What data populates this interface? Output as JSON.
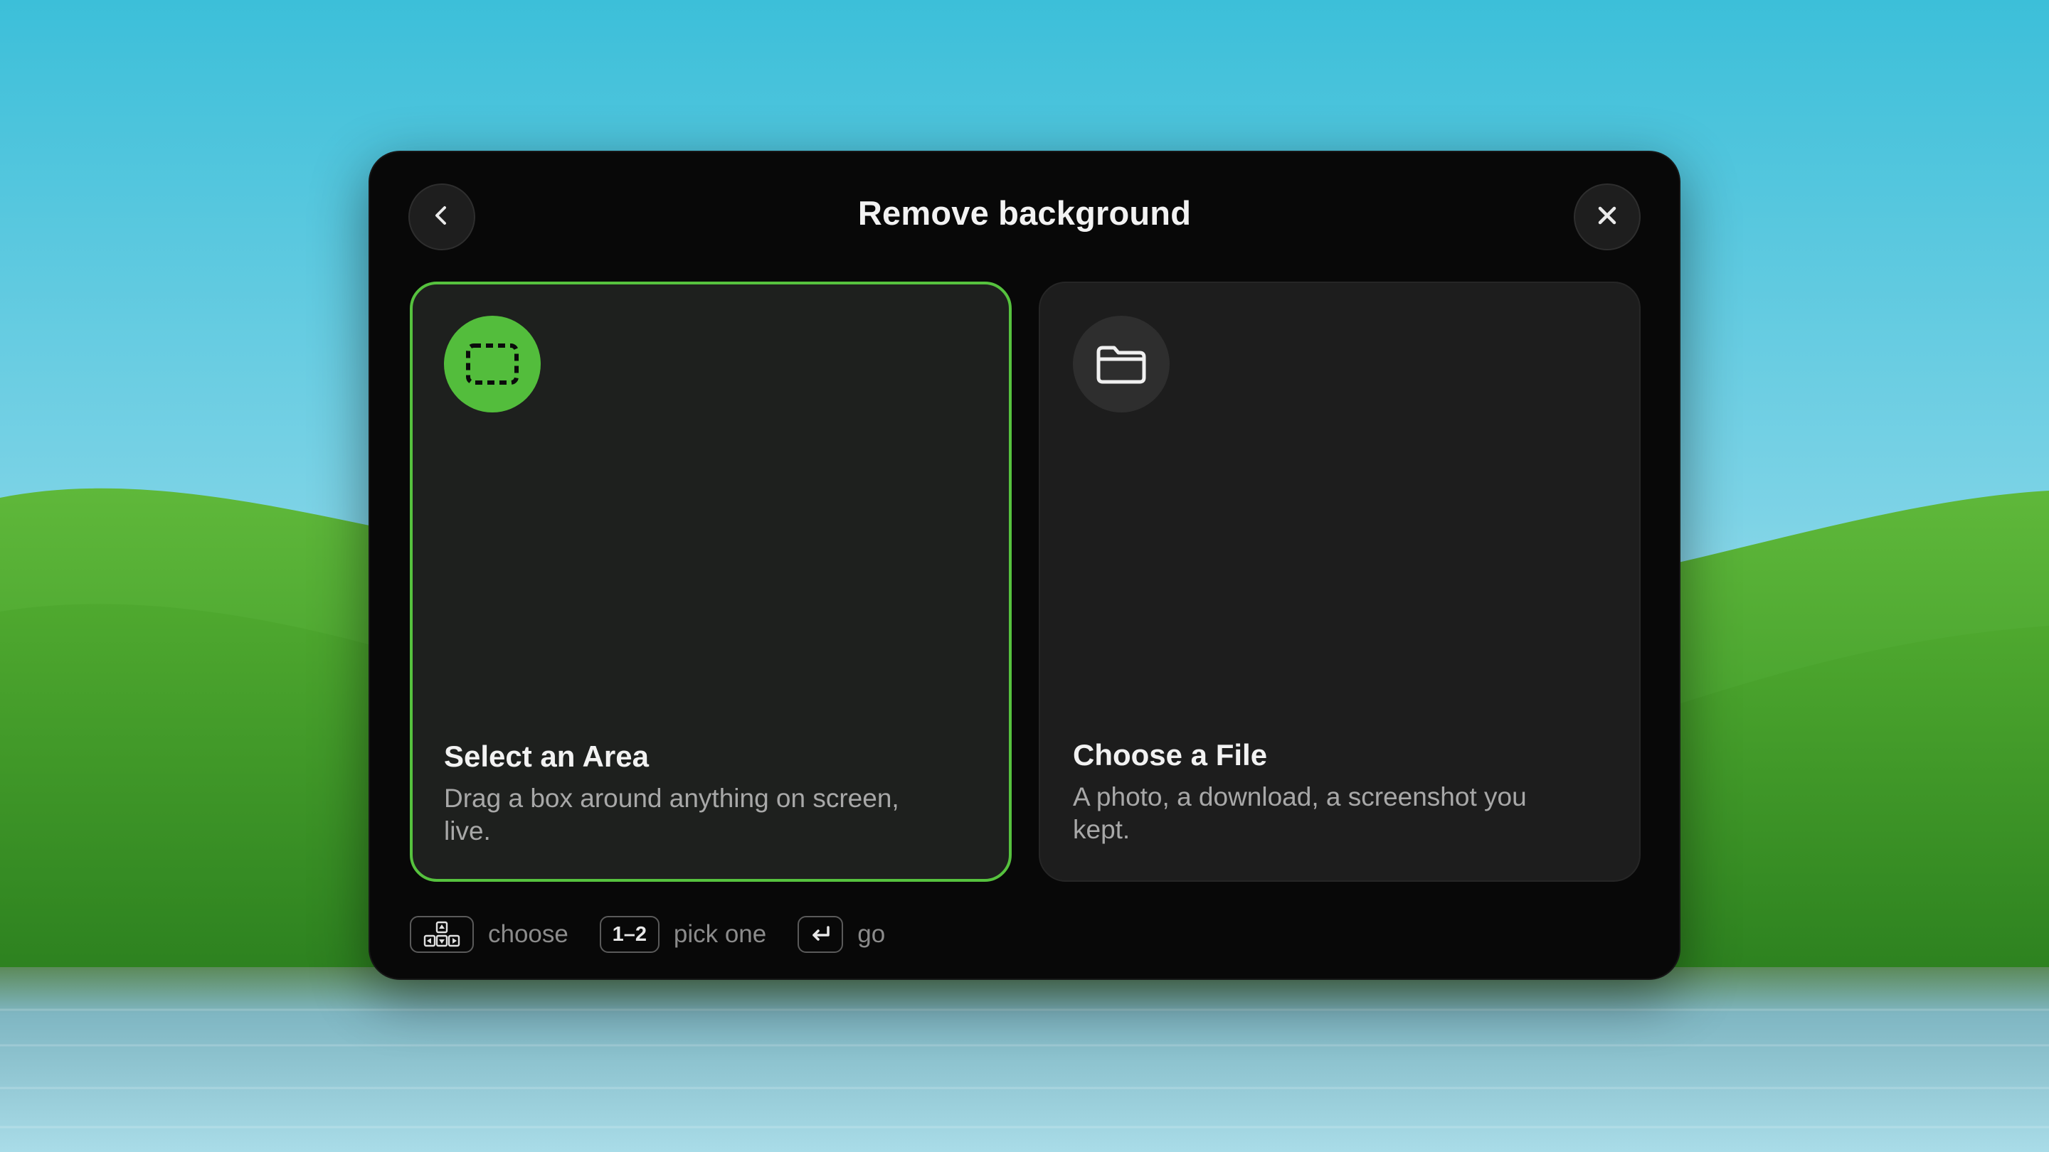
{
  "dialog": {
    "title": "Remove background",
    "back_icon": "chevron-left-icon",
    "close_icon": "close-icon"
  },
  "options": [
    {
      "title": "Select an Area",
      "description": "Drag a box around anything on screen, live.",
      "icon": "selection-marquee-icon",
      "selected": true,
      "accent": "#56c23e"
    },
    {
      "title": "Choose a File",
      "description": "A photo, a download, a screenshot you kept.",
      "icon": "folder-icon",
      "selected": false
    }
  ],
  "hints": [
    {
      "key_icon": "arrow-keys-icon",
      "label": "choose"
    },
    {
      "key": "1–2",
      "label": "pick one"
    },
    {
      "key_icon": "return-key-icon",
      "label": "go"
    }
  ]
}
